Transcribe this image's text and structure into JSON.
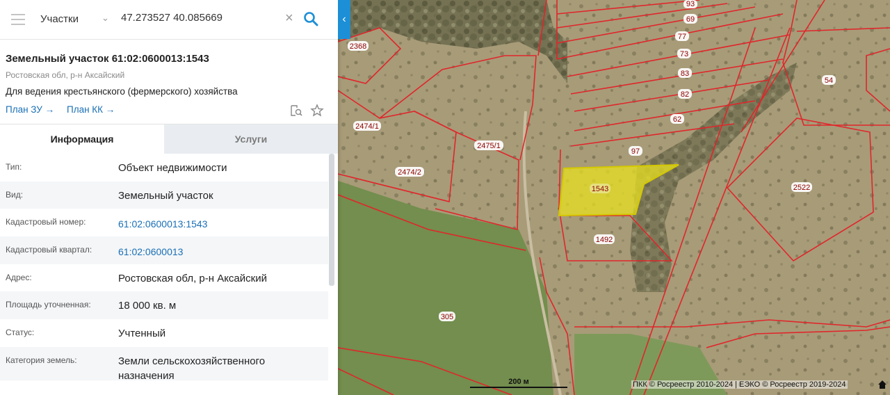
{
  "search": {
    "layer": "Участки",
    "query": "47.273527 40.085669"
  },
  "object": {
    "title": "Земельный участок 61:02:0600013:1543",
    "address_short": "Ростовская обл, р-н Аксайский",
    "purpose": "Для ведения крестьянского (фермерского) хозяйства",
    "link_plan_zu": "План ЗУ →",
    "link_plan_kk": "План КК →"
  },
  "tabs": [
    "Информация",
    "Услуги"
  ],
  "info": [
    {
      "key": "Тип:",
      "value": "Объект недвижимости"
    },
    {
      "key": "Вид:",
      "value": "Земельный участок"
    },
    {
      "key": "Кадастровый номер:",
      "value": "61:02:0600013:1543"
    },
    {
      "key": "Кадастровый квартал:",
      "value": "61:02:0600013"
    },
    {
      "key": "Адрес:",
      "value": "Ростовская обл, р-н Аксайский"
    },
    {
      "key": "Площадь уточненная:",
      "value": "18 000 кв. м"
    },
    {
      "key": "Статус:",
      "value": "Учтенный"
    },
    {
      "key": "Категория земель:",
      "value": "Земли сельскохозяйственного назначения"
    }
  ],
  "map": {
    "parcel_labels": [
      "93",
      "69",
      "77",
      "73",
      "83",
      "82",
      "62",
      "97",
      "54",
      "2368",
      "2474/1",
      "2475/1",
      "2474/2",
      "1543",
      "1492",
      "2522",
      "305"
    ],
    "scale_label": "200 м",
    "attribution": "ПКК © Росреестр 2010-2024 | ЕЭКО © Росреестр 2019-2024",
    "colors": {
      "boundary": "#e0262b",
      "selected_fill": "#e8e020",
      "field": "#6e8a4a",
      "steppe": "#a79a77"
    }
  },
  "icons": [
    "menu-icon",
    "chevron-down-icon",
    "clear-icon",
    "search-icon",
    "collapse-icon",
    "document-search-icon",
    "star-icon",
    "home-icon"
  ]
}
